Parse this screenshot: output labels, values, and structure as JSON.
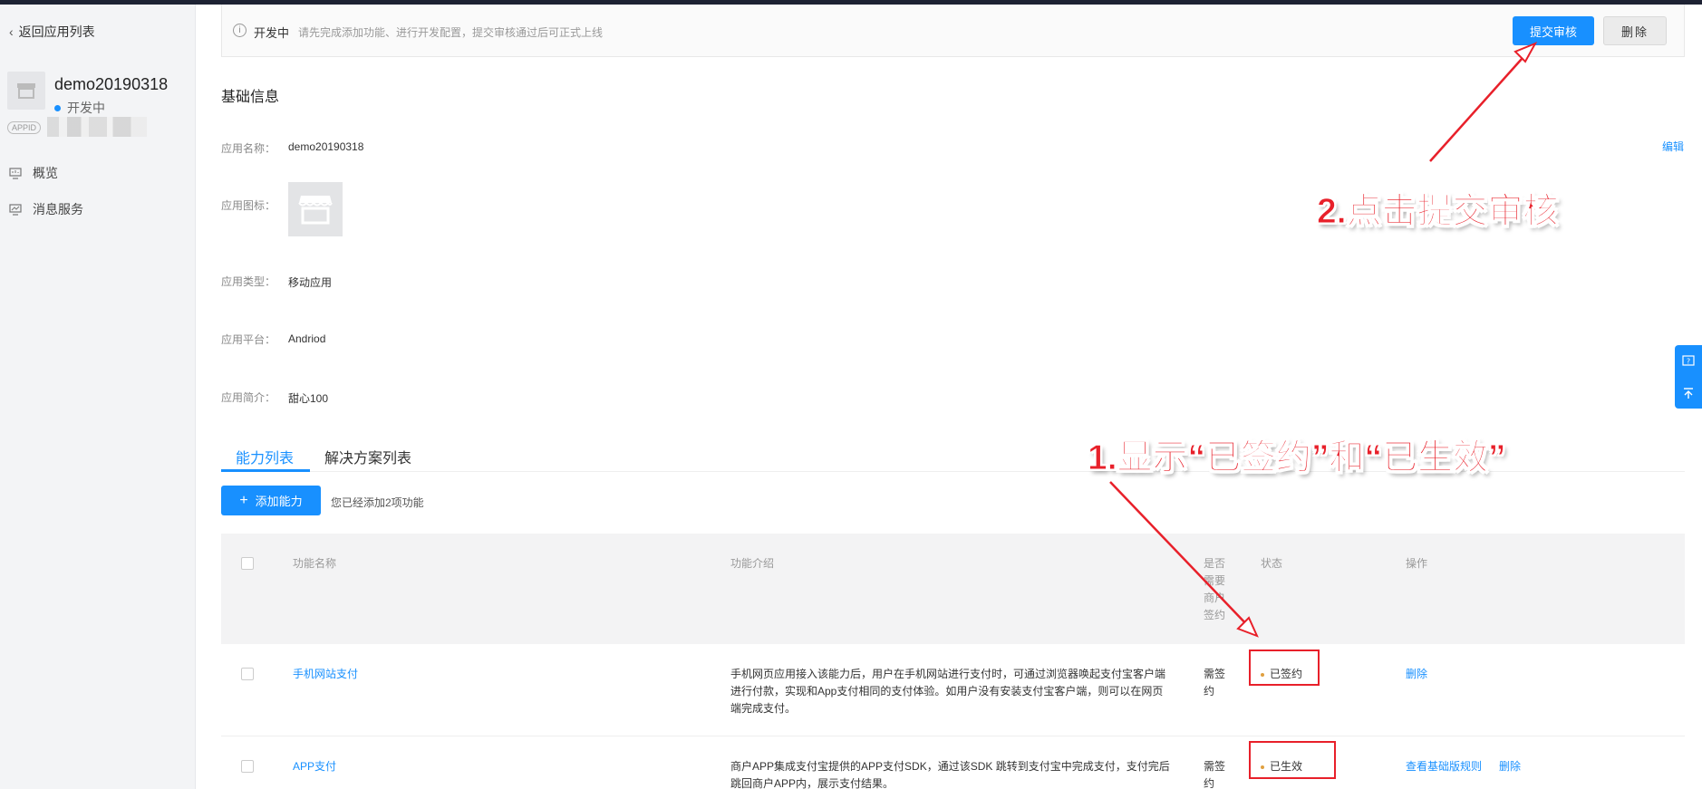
{
  "sidebar": {
    "back_label": "返回应用列表",
    "app_name": "demo20190318",
    "app_status": "开发中",
    "appid_tag": "APPID",
    "nav": [
      {
        "label": "概览",
        "icon": "monitor-icon"
      },
      {
        "label": "消息服务",
        "icon": "chart-icon"
      }
    ]
  },
  "notice": {
    "state": "开发中",
    "message": "请先完成添加功能、进行开发配置，提交审核通过后可正式上线",
    "submit_label": "提交审核",
    "delete_label": "删除"
  },
  "basic_info": {
    "title": "基础信息",
    "edit_label": "编辑",
    "fields": [
      {
        "label": "应用名称：",
        "value": "demo20190318"
      },
      {
        "label": "应用图标：",
        "value": ""
      },
      {
        "label": "应用类型：",
        "value": "移动应用"
      },
      {
        "label": "应用平台：",
        "value": "Andriod"
      },
      {
        "label": "应用简介：",
        "value": "甜心100"
      }
    ]
  },
  "tabs": [
    {
      "label": "能力列表",
      "active": true
    },
    {
      "label": "解决方案列表",
      "active": false
    }
  ],
  "toolbar": {
    "add_label": "添加能力",
    "added_count_text": "您已经添加2项功能"
  },
  "table": {
    "headers": {
      "name": "功能名称",
      "intro": "功能介绍",
      "need_sign": "是否需要商户签约",
      "need_sign_lines": [
        "是否",
        "需要",
        "商户",
        "签约"
      ],
      "status": "状态",
      "action": "操作"
    },
    "rows": [
      {
        "name": "手机网站支付",
        "intro_lines": [
          "手机网页应用接入该能力后，用户在手机网站进行支付时，可通过浏览器唤起支付宝客户端",
          "进行付款，实现和App支付相同的支付体验。如用户没有安装支付宝客户端，则可以在网页",
          "端完成支付。"
        ],
        "need_sign_lines": [
          "需签",
          "约"
        ],
        "status": "已签约",
        "actions": [
          "删除"
        ]
      },
      {
        "name": "APP支付",
        "intro_lines": [
          "商户APP集成支付宝提供的APP支付SDK，通过该SDK 跳转到支付宝中完成支付，支付完后",
          "跳回商户APP内，展示支付结果。"
        ],
        "need_sign_lines": [
          "需签",
          "约"
        ],
        "status": "已生效",
        "actions": [
          "查看基础版规则",
          "删除"
        ]
      }
    ]
  },
  "annotations": {
    "step2": "2.点击提交审核",
    "step1": "1.显示“已签约”和“已生效”",
    "color": "#e8202a"
  },
  "colors": {
    "accent": "#1890ff",
    "status_dot": "#1890ff"
  }
}
